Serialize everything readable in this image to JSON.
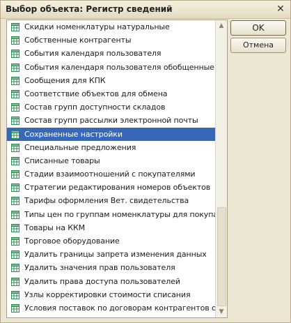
{
  "window": {
    "title": "Выбор объекта: Регистр сведений",
    "close_glyph": "✕"
  },
  "buttons": {
    "ok": "OK",
    "cancel": "Отмена"
  },
  "scrollbar": {
    "up": "▲",
    "down": "▼"
  },
  "list": {
    "items": [
      {
        "label": "Скидки номенклатуры натуральные",
        "selected": false
      },
      {
        "label": "Собственные контрагенты",
        "selected": false
      },
      {
        "label": "События календаря пользователя",
        "selected": false
      },
      {
        "label": "События календаря пользователя обобщенные",
        "selected": false
      },
      {
        "label": "Сообщения для КПК",
        "selected": false
      },
      {
        "label": "Соответствие объектов для обмена",
        "selected": false
      },
      {
        "label": "Состав групп доступности складов",
        "selected": false
      },
      {
        "label": "Состав групп рассылки электронной почты",
        "selected": false
      },
      {
        "label": "Сохраненные настройки",
        "selected": true
      },
      {
        "label": "Специальные предложения",
        "selected": false
      },
      {
        "label": "Списанные товары",
        "selected": false
      },
      {
        "label": "Стадии взаимоотношений с покупателями",
        "selected": false
      },
      {
        "label": "Стратегии редактирования номеров объектов",
        "selected": false
      },
      {
        "label": "Тарифы оформления Вет. свидетельства",
        "selected": false
      },
      {
        "label": "Типы цен по группам номенклатуры для покупате...",
        "selected": false
      },
      {
        "label": "Товары на ККМ",
        "selected": false
      },
      {
        "label": "Торговое оборудование",
        "selected": false
      },
      {
        "label": "Удалить границы запрета изменения данных",
        "selected": false
      },
      {
        "label": "Удалить значения прав пользователя",
        "selected": false
      },
      {
        "label": "Удалить права доступа пользователей",
        "selected": false
      },
      {
        "label": "Узлы корректировки стоимости списания",
        "selected": false
      },
      {
        "label": "Условия поставок по договорам контрагентов об...",
        "selected": false
      },
      {
        "label": "",
        "selected": false
      }
    ]
  },
  "colors": {
    "selection": "#3868b8",
    "icon_green": "#2e8b57"
  }
}
